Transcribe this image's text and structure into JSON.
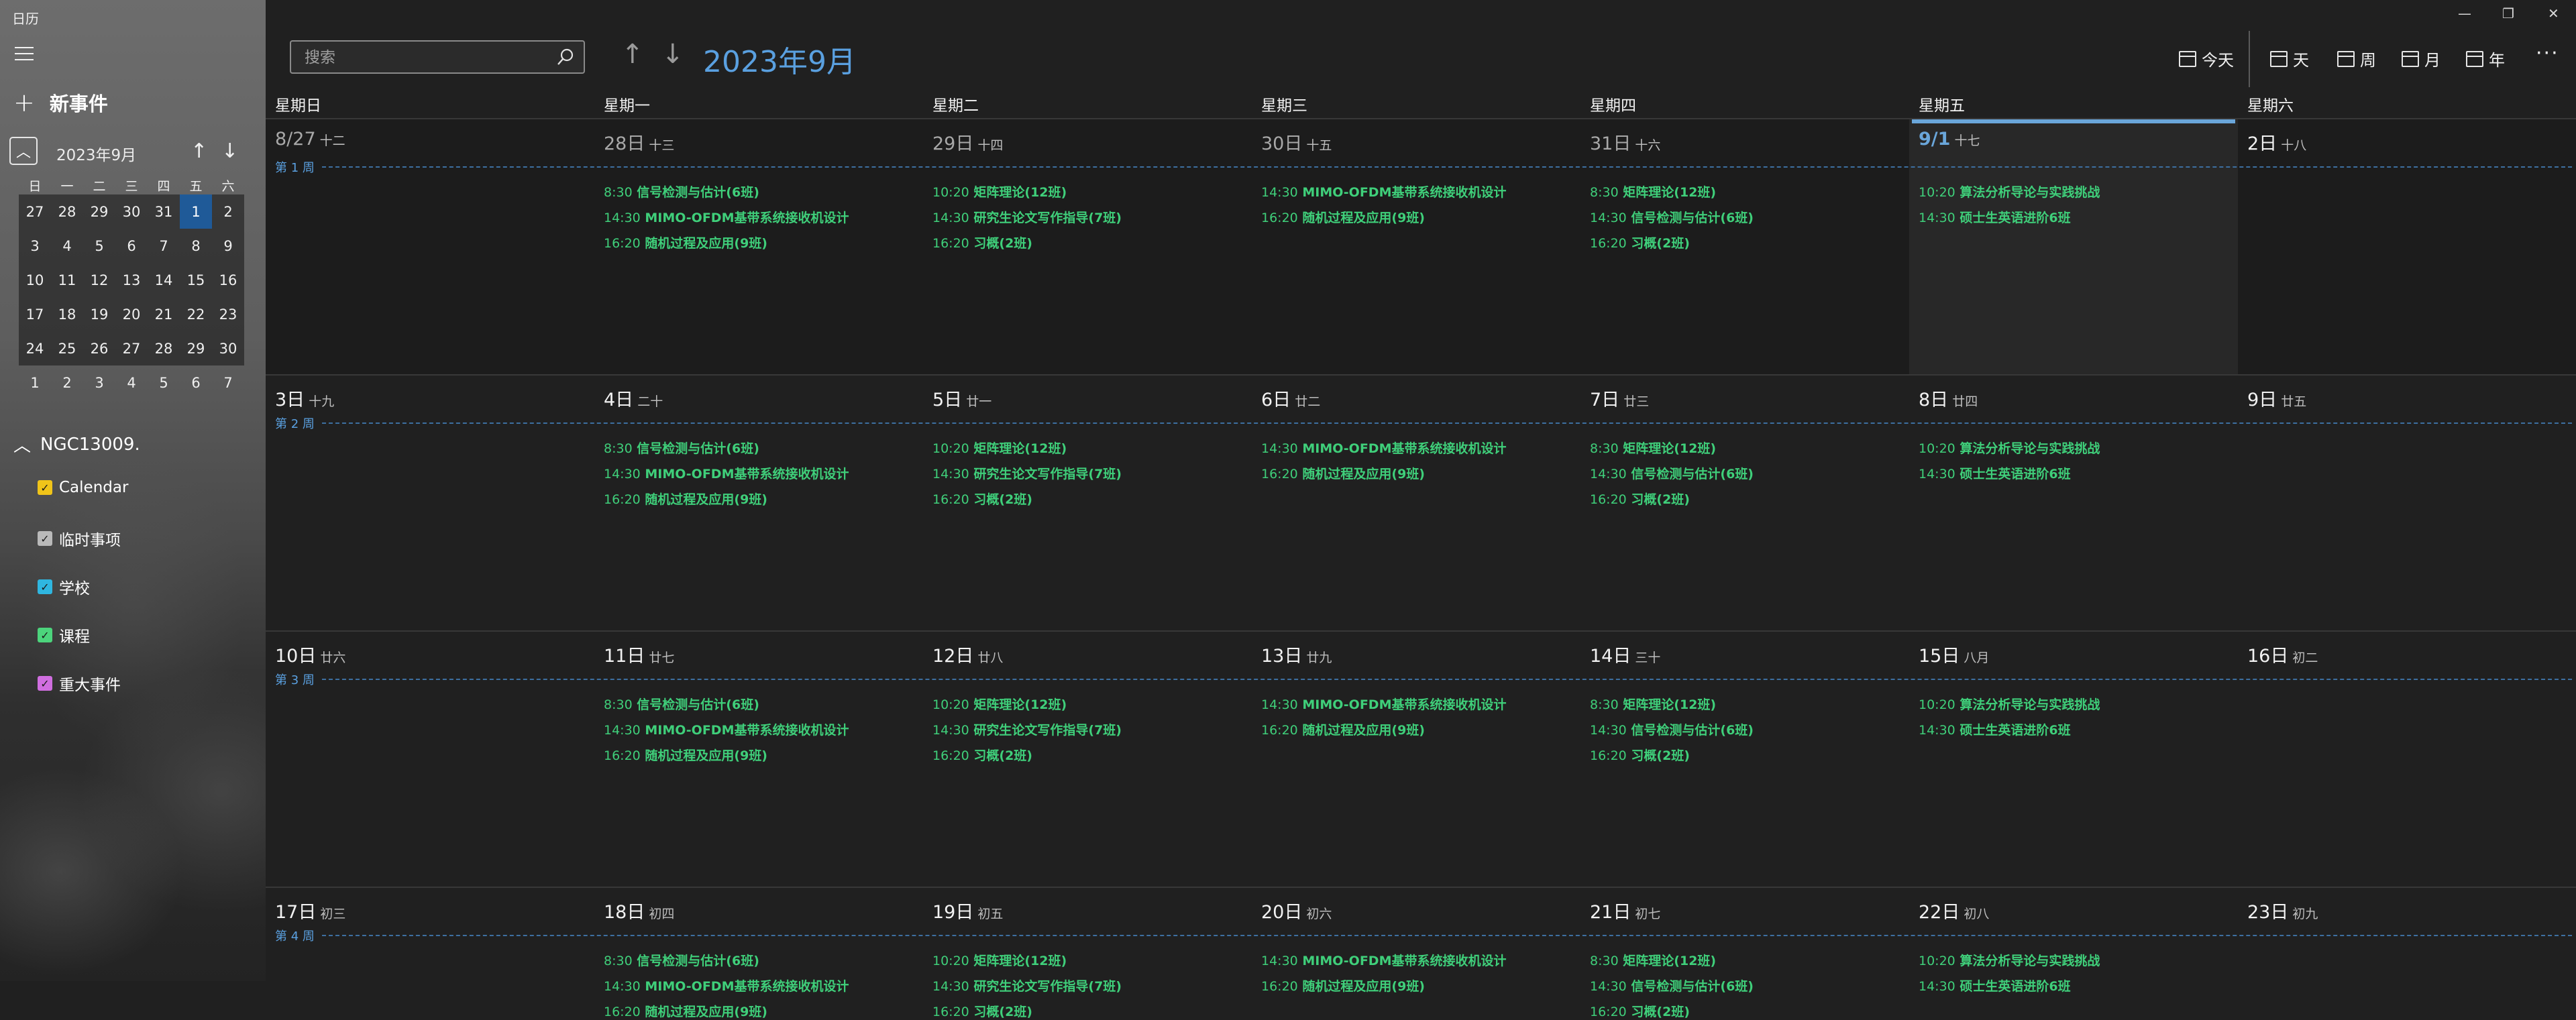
{
  "app": {
    "title": "日历"
  },
  "sidebar": {
    "new_event_label": "新事件",
    "mini_calendar": {
      "title": "2023年9月",
      "weekdays": [
        "日",
        "一",
        "二",
        "三",
        "四",
        "五",
        "六"
      ],
      "weeks": [
        [
          "27",
          "28",
          "29",
          "30",
          "31",
          "1",
          "2"
        ],
        [
          "3",
          "4",
          "5",
          "6",
          "7",
          "8",
          "9"
        ],
        [
          "10",
          "11",
          "12",
          "13",
          "14",
          "15",
          "16"
        ],
        [
          "17",
          "18",
          "19",
          "20",
          "21",
          "22",
          "23"
        ],
        [
          "24",
          "25",
          "26",
          "27",
          "28",
          "29",
          "30"
        ],
        [
          "1",
          "2",
          "3",
          "4",
          "5",
          "6",
          "7"
        ]
      ],
      "selected": "9/1"
    },
    "account_label": "NGC13009.",
    "calendars": [
      {
        "label": "Calendar",
        "color": "#f0c419"
      },
      {
        "label": "临时事项",
        "color": "#b9b9b9"
      },
      {
        "label": "学校",
        "color": "#2fb6e0"
      },
      {
        "label": "课程",
        "color": "#4cd47c"
      },
      {
        "label": "重大事件",
        "color": "#d06ee0"
      }
    ]
  },
  "toolbar": {
    "search_placeholder": "搜索",
    "month_title": "2023年9月",
    "views": [
      {
        "label": "今天",
        "icon": "calendar-today-icon"
      },
      {
        "label": "天",
        "icon": "calendar-day-icon"
      },
      {
        "label": "周",
        "icon": "calendar-week-icon"
      },
      {
        "label": "月",
        "icon": "calendar-month-icon"
      },
      {
        "label": "年",
        "icon": "calendar-year-icon"
      }
    ],
    "more_label": "···"
  },
  "colors": {
    "accent": "#5aa0e0",
    "event": "#3fcf7a",
    "background": "#202020"
  },
  "weekdays": [
    "星期日",
    "星期一",
    "星期二",
    "星期三",
    "星期四",
    "星期五",
    "星期六"
  ],
  "weeks": [
    {
      "label": "第 1 周",
      "days": [
        {
          "date": "8/27",
          "lunar": "十二",
          "state": "prev",
          "events": []
        },
        {
          "date": "28日",
          "lunar": "十三",
          "state": "prev",
          "events": [
            "Mon"
          ]
        },
        {
          "date": "29日",
          "lunar": "十四",
          "state": "prev",
          "events": [
            "Tue"
          ]
        },
        {
          "date": "30日",
          "lunar": "十五",
          "state": "prev",
          "events": [
            "Wed"
          ]
        },
        {
          "date": "31日",
          "lunar": "十六",
          "state": "prev",
          "events": [
            "Thu"
          ]
        },
        {
          "date": "9/1",
          "lunar": "十七",
          "state": "today",
          "events": [
            "Fri"
          ]
        },
        {
          "date": "2日",
          "lunar": "十八",
          "state": "",
          "events": []
        }
      ]
    },
    {
      "label": "第 2 周",
      "days": [
        {
          "date": "3日",
          "lunar": "十九",
          "state": "",
          "events": []
        },
        {
          "date": "4日",
          "lunar": "二十",
          "state": "",
          "events": [
            "Mon"
          ]
        },
        {
          "date": "5日",
          "lunar": "廿一",
          "state": "",
          "events": [
            "Tue"
          ]
        },
        {
          "date": "6日",
          "lunar": "廿二",
          "state": "",
          "events": [
            "Wed"
          ]
        },
        {
          "date": "7日",
          "lunar": "廿三",
          "state": "",
          "events": [
            "Thu"
          ]
        },
        {
          "date": "8日",
          "lunar": "廿四",
          "state": "",
          "events": [
            "Fri"
          ]
        },
        {
          "date": "9日",
          "lunar": "廿五",
          "state": "",
          "events": []
        }
      ]
    },
    {
      "label": "第 3 周",
      "days": [
        {
          "date": "10日",
          "lunar": "廿六",
          "state": "",
          "events": []
        },
        {
          "date": "11日",
          "lunar": "廿七",
          "state": "",
          "events": [
            "Mon"
          ]
        },
        {
          "date": "12日",
          "lunar": "廿八",
          "state": "",
          "events": [
            "Tue"
          ]
        },
        {
          "date": "13日",
          "lunar": "廿九",
          "state": "",
          "events": [
            "Wed"
          ]
        },
        {
          "date": "14日",
          "lunar": "三十",
          "state": "",
          "events": [
            "Thu"
          ]
        },
        {
          "date": "15日",
          "lunar": "八月",
          "state": "",
          "events": [
            "Fri"
          ]
        },
        {
          "date": "16日",
          "lunar": "初二",
          "state": "",
          "events": []
        }
      ]
    },
    {
      "label": "第 4 周",
      "days": [
        {
          "date": "17日",
          "lunar": "初三",
          "state": "",
          "events": []
        },
        {
          "date": "18日",
          "lunar": "初四",
          "state": "",
          "events": [
            "Mon"
          ]
        },
        {
          "date": "19日",
          "lunar": "初五",
          "state": "",
          "events": [
            "Tue"
          ]
        },
        {
          "date": "20日",
          "lunar": "初六",
          "state": "",
          "events": [
            "Wed"
          ]
        },
        {
          "date": "21日",
          "lunar": "初七",
          "state": "",
          "events": [
            "Thu"
          ]
        },
        {
          "date": "22日",
          "lunar": "初八",
          "state": "",
          "events": [
            "Fri"
          ]
        },
        {
          "date": "23日",
          "lunar": "初九",
          "state": "",
          "events": []
        }
      ]
    }
  ],
  "event_sets": {
    "Mon": [
      {
        "time": "8:30",
        "title": "信号检测与估计(6班)"
      },
      {
        "time": "14:30",
        "title": "MIMO-OFDM基带系统接收机设计"
      },
      {
        "time": "16:20",
        "title": "随机过程及应用(9班)"
      }
    ],
    "Tue": [
      {
        "time": "10:20",
        "title": "矩阵理论(12班)"
      },
      {
        "time": "14:30",
        "title": "研究生论文写作指导(7班)"
      },
      {
        "time": "16:20",
        "title": "习概(2班)"
      }
    ],
    "Wed": [
      {
        "time": "14:30",
        "title": "MIMO-OFDM基带系统接收机设计"
      },
      {
        "time": "16:20",
        "title": "随机过程及应用(9班)"
      }
    ],
    "Thu": [
      {
        "time": "8:30",
        "title": "矩阵理论(12班)"
      },
      {
        "time": "14:30",
        "title": "信号检测与估计(6班)"
      },
      {
        "time": "16:20",
        "title": "习概(2班)"
      }
    ],
    "Fri": [
      {
        "time": "10:20",
        "title": "算法分析导论与实践挑战"
      },
      {
        "time": "14:30",
        "title": "硕士生英语进阶6班"
      }
    ]
  }
}
